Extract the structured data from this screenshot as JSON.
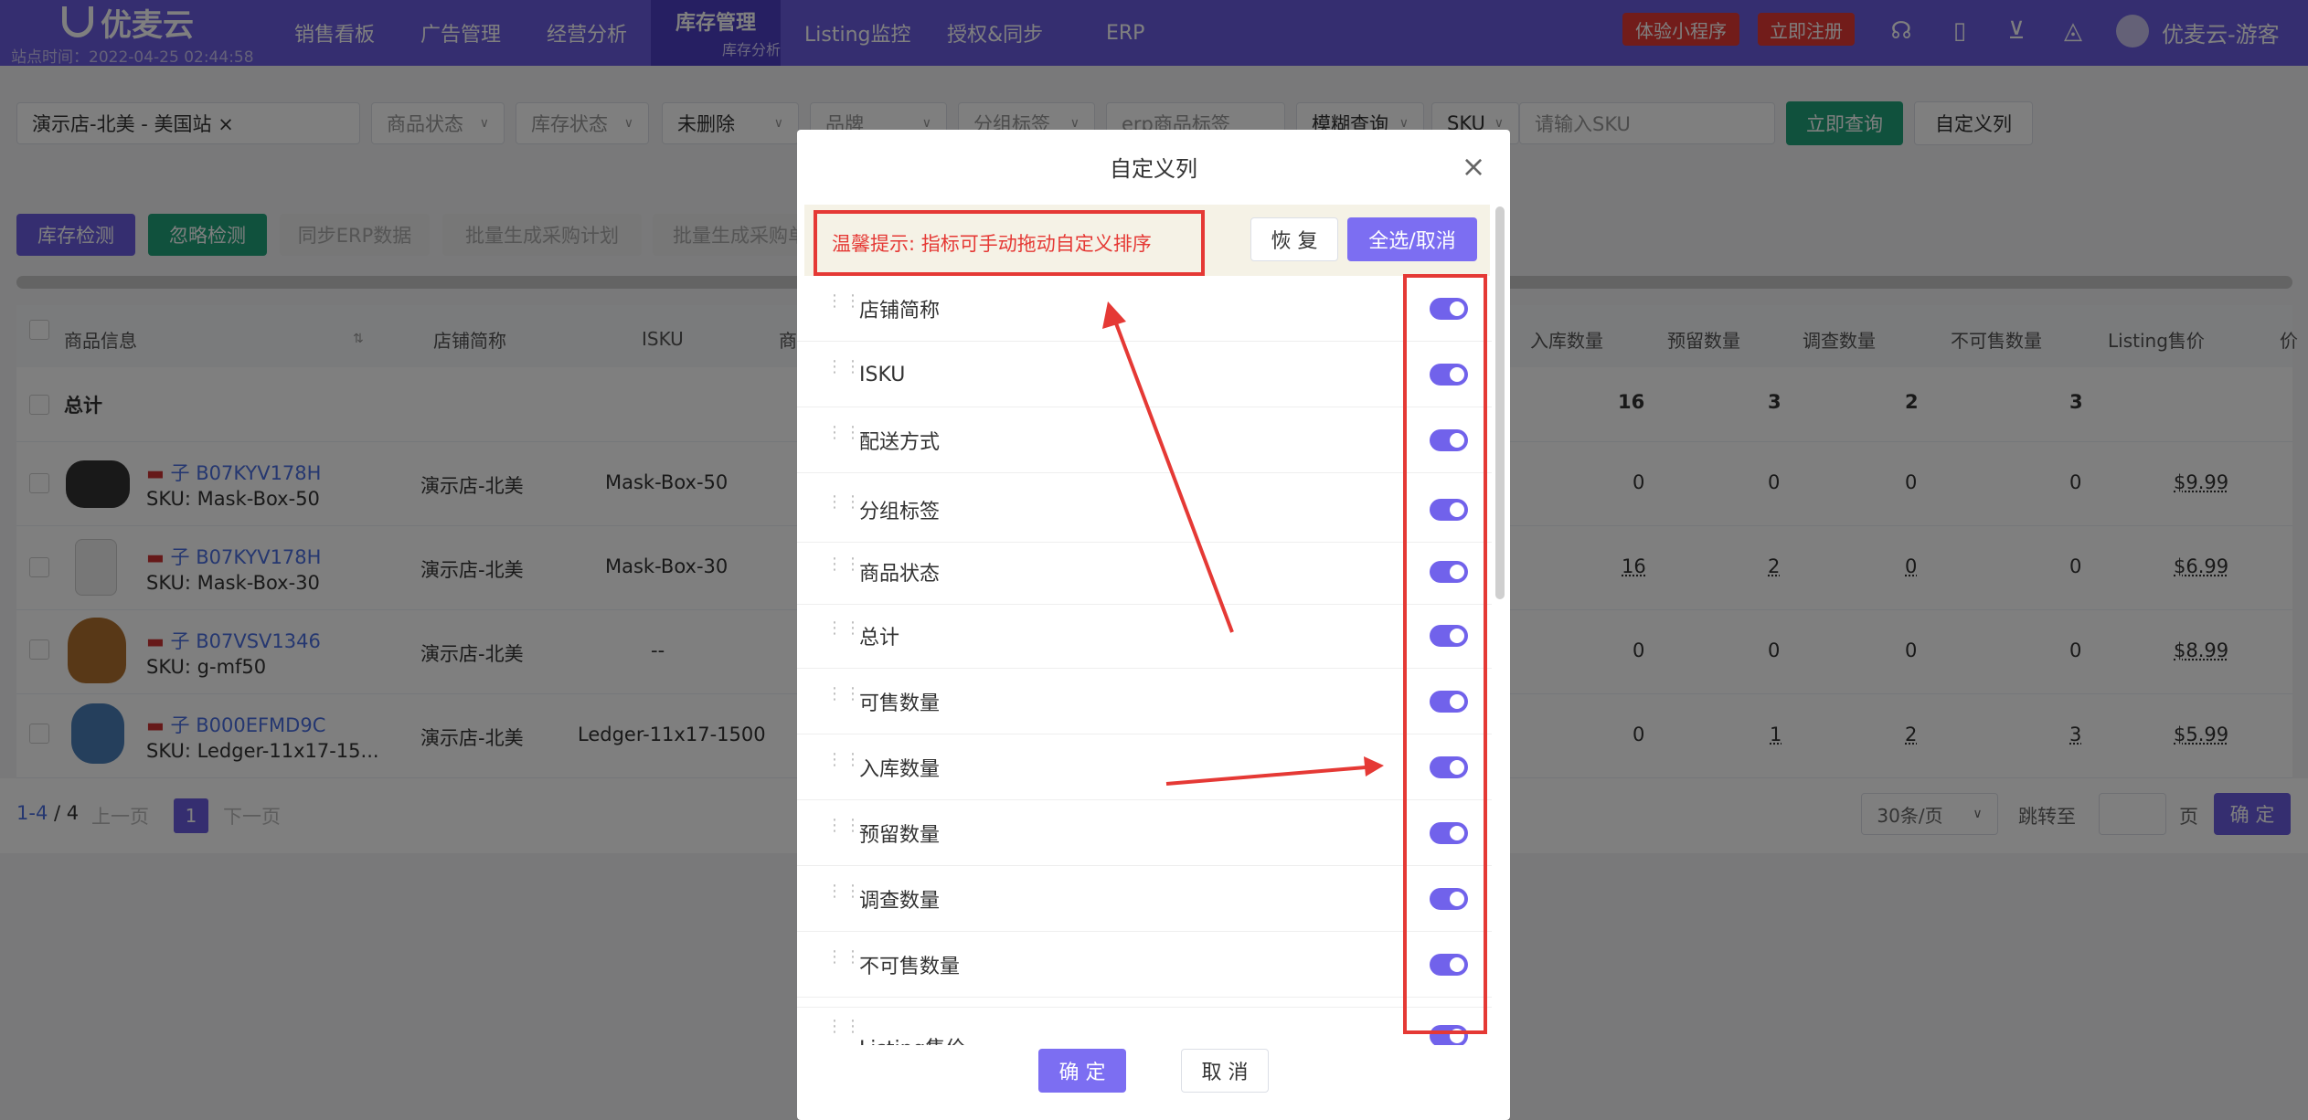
{
  "nav": {
    "logo": "优麦云",
    "site_time": "站点时间：2022-04-25 02:44:58",
    "items": [
      "销售看板",
      "广告管理",
      "经营分析",
      "库存管理",
      "Listing监控",
      "授权&同步",
      "ERP"
    ],
    "active_sub": "库存分析",
    "btn_miniapp": "体验小程序",
    "btn_register": "立即注册",
    "username": "优麦云-游客"
  },
  "filters": {
    "store": "演示店-北美 - 美国站",
    "product_status": "商品状态",
    "stock_status": "库存状态",
    "deleted": "未删除",
    "brand": "品牌",
    "group_tag": "分组标签",
    "erp_tag": "erp商品标签",
    "fuzzy": "模糊查询",
    "sku": "SKU",
    "sku_placeholder": "请输入SKU",
    "query_btn": "立即查询",
    "custom_col_btn": "自定义列"
  },
  "actions": [
    "库存检测",
    "忽略检测",
    "同步ERP数据",
    "批量生成采购计划",
    "批量生成采购单"
  ],
  "table": {
    "headers": {
      "product": "商品信息",
      "store": "店铺简称",
      "isku": "ISKU",
      "col4": "商",
      "inbound": "入库数量",
      "reserved": "预留数量",
      "survey": "调查数量",
      "unsellable": "不可售数量",
      "price": "Listing售价",
      "more": "价"
    },
    "total": {
      "label": "总计",
      "inbound": "16",
      "reserved": "3",
      "survey": "2",
      "unsellable": "3"
    },
    "rows": [
      {
        "asin": "B07KYV178H",
        "prefix": "子",
        "sku": "SKU: Mask-Box-50",
        "store": "演示店-北美",
        "isku": "Mask-Box-50",
        "inbound": "0",
        "reserved": "0",
        "survey": "0",
        "unsellable": "0",
        "price": "$9.99"
      },
      {
        "asin": "B07KYV178H",
        "prefix": "子",
        "sku": "SKU: Mask-Box-30",
        "store": "演示店-北美",
        "isku": "Mask-Box-30",
        "inbound": "16",
        "reserved": "2",
        "survey": "0",
        "unsellable": "0",
        "price": "$6.99"
      },
      {
        "asin": "B07VSV1346",
        "prefix": "子",
        "sku": "SKU: g-mf50",
        "store": "演示店-北美",
        "isku": "--",
        "inbound": "0",
        "reserved": "0",
        "survey": "0",
        "unsellable": "0",
        "price": "$8.99"
      },
      {
        "asin": "B000EFMD9C",
        "prefix": "子",
        "sku": "SKU: Ledger-11x17-15...",
        "store": "演示店-北美",
        "isku": "Ledger-11x17-1500",
        "inbound": "0",
        "reserved": "1",
        "survey": "2",
        "unsellable": "3",
        "price": "$5.99"
      }
    ]
  },
  "pagination": {
    "range": "1-4",
    "total": "/ 4",
    "prev": "上一页",
    "page": "1",
    "next": "下一页",
    "per_page": "30条/页",
    "jump": "跳转至",
    "page_unit": "页",
    "confirm": "确 定"
  },
  "modal": {
    "title": "自定义列",
    "tip": "温馨提示: 指标可手动拖动自定义排序",
    "restore": "恢 复",
    "select_all": "全选/取消",
    "columns": [
      "店铺简称",
      "ISKU",
      "配送方式",
      "分组标签",
      "商品状态",
      "总计",
      "可售数量",
      "入库数量",
      "预留数量",
      "调查数量",
      "不可售数量",
      "Listing售价"
    ],
    "ok": "确 定",
    "cancel": "取 消"
  },
  "colors": {
    "primary": "#6b5ce0",
    "accent": "#7c6ef2",
    "green": "#20a37a",
    "red": "#e53935"
  }
}
